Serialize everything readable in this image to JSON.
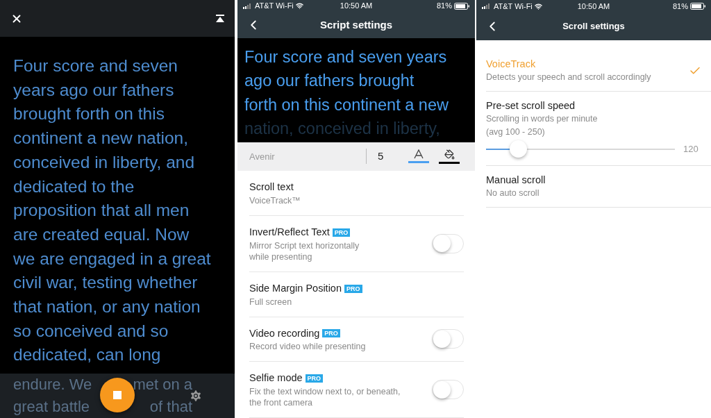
{
  "teleprompter": {
    "script_lines": [
      "Four score and seven",
      "years ago our fathers",
      "brought forth on this",
      "continent a new nation,",
      "conceived in liberty, and",
      "dedicated to the",
      "proposition that all men",
      "are created equal. Now",
      "we are engaged in a great",
      "civil war, testing whether",
      "that nation, or any nation",
      "so conceived and so",
      "dedicated, can long"
    ],
    "covered_lines": [
      {
        "left": "endure. We",
        "right": "met on a"
      },
      {
        "left": "great battle",
        "right": "of that"
      }
    ]
  },
  "script_settings": {
    "status_bar": {
      "carrier": "AT&T Wi-Fi",
      "time": "10:50 AM",
      "battery": "81%"
    },
    "title": "Script settings",
    "preview_lines": [
      {
        "text": "Four score and seven years",
        "faded": false
      },
      {
        "text": "ago our fathers brought",
        "faded": false
      },
      {
        "text": "forth on this continent a new",
        "faded": false
      },
      {
        "text": "nation, conceived in liberty,",
        "faded": true
      }
    ],
    "toolbar": {
      "font": "Avenir",
      "size": "5"
    },
    "items": [
      {
        "kind": "link",
        "title": "Scroll text",
        "subtitle_lines": [
          "VoiceTrack™"
        ]
      },
      {
        "kind": "toggle",
        "title": "Invert/Reflect Text",
        "badge": "PRO",
        "subtitle_lines": [
          "Mirror Script text horizontally",
          "while presenting"
        ],
        "on": false
      },
      {
        "kind": "link",
        "title": "Side Margin Position",
        "badge": "PRO",
        "subtitle_lines": [
          "Full screen"
        ]
      },
      {
        "kind": "toggle",
        "title": "Video recording",
        "badge": "PRO",
        "subtitle_lines": [
          "Record video while presenting"
        ],
        "on": false
      },
      {
        "kind": "toggle",
        "title": "Selfie mode",
        "badge": "PRO",
        "subtitle_lines": [
          "Fix the text window next to, or beneath,",
          "the front camera"
        ],
        "on": false
      }
    ]
  },
  "scroll_settings": {
    "status_bar": {
      "carrier": "AT&T Wi-Fi",
      "time": "10:50 AM",
      "battery": "81%"
    },
    "title": "Scroll settings",
    "options": [
      {
        "kind": "choice",
        "title": "VoiceTrack",
        "subtitle_lines": [
          "Detects your speech and scroll accordingly"
        ],
        "selected": true
      },
      {
        "kind": "slider",
        "title": "Pre-set scroll speed",
        "subtitle_lines": [
          "Scrolling in words per minute",
          "(avg 100 - 250)"
        ],
        "level": 0.17,
        "reading": "120",
        "selected": false
      },
      {
        "kind": "choice",
        "title": "Manual scroll",
        "subtitle_lines": [
          "No auto scroll"
        ],
        "selected": false
      }
    ]
  }
}
